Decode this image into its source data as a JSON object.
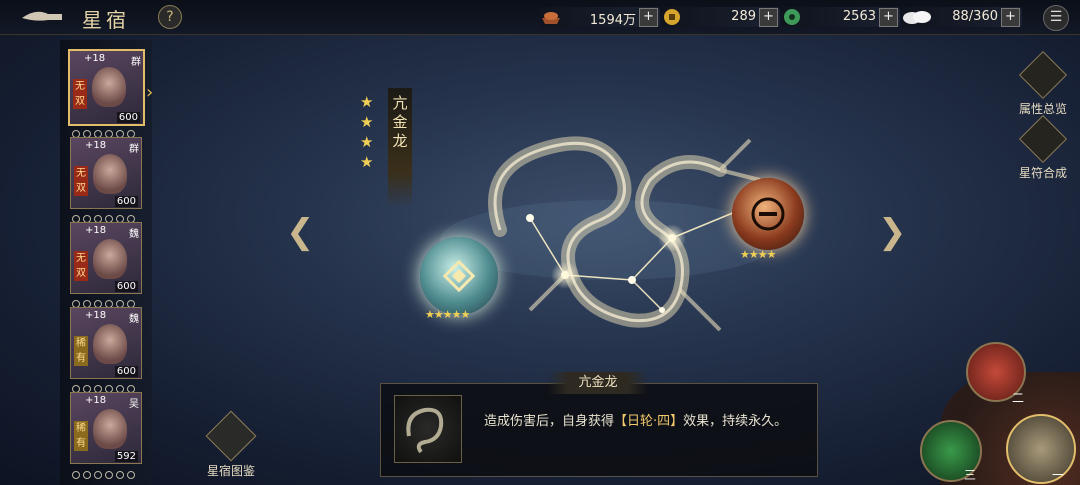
{
  "header": {
    "title": "星宿",
    "help_label": "?",
    "resources": [
      {
        "name": "silver",
        "value": "1594万",
        "icon": "silver-ingot-icon"
      },
      {
        "name": "coins",
        "value": "289",
        "icon": "gold-coin-icon"
      },
      {
        "name": "jade",
        "value": "2563",
        "icon": "jade-coin-icon"
      },
      {
        "name": "stamina",
        "value": "88/360",
        "icon": "steamed-bun-icon"
      }
    ],
    "plus_label": "+",
    "menu_label": "☰"
  },
  "heroes": [
    {
      "level": "+18",
      "faction": "群",
      "tag": "无双",
      "power": "600",
      "selected": true
    },
    {
      "level": "+18",
      "faction": "群",
      "tag": "无双",
      "power": "600",
      "selected": false
    },
    {
      "level": "+18",
      "faction": "魏",
      "tag": "无双",
      "power": "600",
      "selected": false
    },
    {
      "level": "+18",
      "faction": "魏",
      "tag": "稀有",
      "power": "600",
      "selected": false
    },
    {
      "level": "+18",
      "faction": "吴",
      "tag": "稀有",
      "power": "592",
      "selected": false
    }
  ],
  "atlas_label": "星宿图鉴",
  "constellation": {
    "name": "亢金龙",
    "rank_stars": 4,
    "left_orb_stars": 5,
    "right_orb_stars": 4
  },
  "description": {
    "title": "亢金龙",
    "text_before": "造成伤害后，自身获得",
    "highlight": "【日轮·四】",
    "text_after": "效果，持续永久。"
  },
  "side_buttons": {
    "attributes_label": "属性总览",
    "synthesis_label": "星符合成"
  },
  "wheel": {
    "top_label": "二",
    "left_label": "三",
    "right_label": "一"
  },
  "colors": {
    "accent_gold": "#e2bd6a",
    "star": "#f1cf55",
    "tag_red": "#9a2a18"
  }
}
